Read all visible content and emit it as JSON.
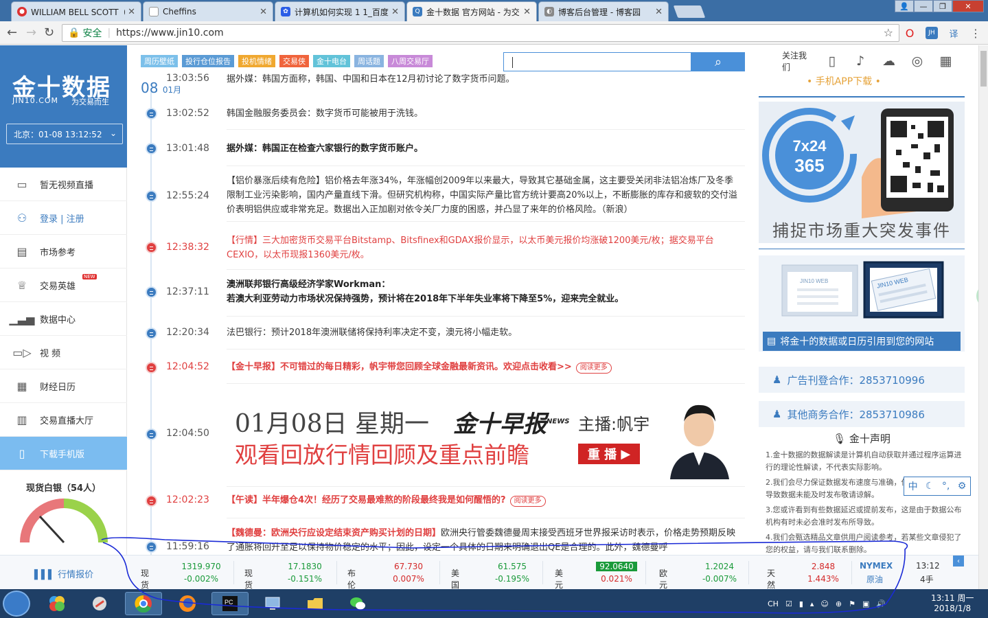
{
  "browser": {
    "tabs": [
      {
        "label": "WILLIAM BELL SCOTT（",
        "icon": "red-circle-icon",
        "active": false
      },
      {
        "label": "Cheffins",
        "icon": "page-icon",
        "active": false
      },
      {
        "label": "计算机如何实现 1 1_百度",
        "icon": "baidu-paw-icon",
        "active": false
      },
      {
        "label": "金十数据 官方网站 - 为交",
        "icon": "jin10-q-icon",
        "active": true
      },
      {
        "label": "博客后台管理 - 博客园",
        "icon": "cnblogs-icon",
        "active": false
      }
    ],
    "secure_label": "安全",
    "url": "https://www.jin10.com"
  },
  "sidebar": {
    "logo": "金十数据",
    "domain": "JIN10.COM",
    "slogan": "为交易而生",
    "clock": "北京：01-08 13:12:52",
    "items": [
      {
        "label": "暂无视频直播",
        "icon": "tv-icon"
      },
      {
        "label": "登录 | 注册",
        "icon": "user-icon"
      },
      {
        "label": "市场参考",
        "icon": "news-icon"
      },
      {
        "label": "交易英雄",
        "icon": "trophy-icon",
        "badge": "NEW"
      },
      {
        "label": "数据中心",
        "icon": "bar-chart-icon"
      },
      {
        "label": "视  频",
        "icon": "video-icon"
      },
      {
        "label": "财经日历",
        "icon": "calendar-icon"
      },
      {
        "label": "交易直播大厅",
        "icon": "live-chart-icon"
      },
      {
        "label": "下载手机版",
        "icon": "phone-icon"
      }
    ],
    "silver_title": "现货白银（54人）"
  },
  "main": {
    "tags": [
      {
        "label": "周历壁纸",
        "color": "#7cc0ea"
      },
      {
        "label": "投行仓位报告",
        "color": "#5b9bd5"
      },
      {
        "label": "投机情绪",
        "color": "#f0a830"
      },
      {
        "label": "交易侠",
        "color": "#f0643c"
      },
      {
        "label": "金十电台",
        "color": "#62c3d9"
      },
      {
        "label": "周话题",
        "color": "#8ab4e0"
      },
      {
        "label": "八周交易厅",
        "color": "#c88ad8"
      }
    ],
    "date_day": "08",
    "date_month": "01月",
    "feed": [
      {
        "time": "13:03:56",
        "text": "据外媒：韩国方面称，韩国、中国和日本在12月初讨论了数字货币问题。",
        "red": false,
        "bold": false
      },
      {
        "time": "13:02:52",
        "text": "韩国金融服务委员会：数字货币可能被用于洗钱。",
        "red": false,
        "bold": false
      },
      {
        "time": "13:01:48",
        "text": "据外媒：韩国正在检查六家银行的数字货币账户。",
        "red": false,
        "bold": true
      },
      {
        "time": "12:55:24",
        "text": "【铝价暴涨后续有危险】铝价格去年涨34%，年涨幅创2009年以来最大，导致其它基础金属，这主要受关闭非法铝冶炼厂及冬季限制工业污染影响，国内产量直线下滑。但研究机构称，中国实际产量比官方统计要高20%以上，不断膨胀的库存和疲软的交付溢价表明铝供应或非常充足。数据出入正加剧对依令关厂力度的困惑，并凸显了来年的价格风险。（新浪）",
        "red": false,
        "bold": false
      },
      {
        "time": "12:38:32",
        "text": "【行情】三大加密货币交易平台Bitstamp、Bitsfinex和GDAX报价显示，以太币美元报价均涨破1200美元/枚；据交易平台CEXIO，以太币现报1360美元/枚。",
        "red": true,
        "bold": false
      },
      {
        "time": "12:37:11",
        "text": "澳洲联邦银行高级经济学家Workman：",
        "text2": "若澳大利亚劳动力市场状况保持强势，预计将在2018年下半年失业率将下降至5%，迎来完全就业。",
        "red": false,
        "bold": true
      },
      {
        "time": "12:20:34",
        "text": "法巴银行：预计2018年澳洲联储将保持利率决定不变，澳元将小幅走软。",
        "red": false,
        "bold": false
      },
      {
        "time": "12:04:52",
        "text": "【金十早报】不可错过的每日精彩，帆宇带您回顾全球金融最新资讯。欢迎点击收看>>",
        "red": true,
        "bold": true,
        "more": "阅读更多"
      },
      {
        "time": "12:04:50",
        "text": "",
        "red": false,
        "bold": false
      },
      {
        "time": "12:02:23",
        "text": "【午读】半年爆仓4次！经历了交易最难熬的阶段最终我是如何醒悟的?",
        "red": true,
        "bold": true,
        "more": "阅读更多"
      },
      {
        "time": "11:59:16",
        "text": "【魏德曼：欧洲央行应设定结束资产购买计划的日期】",
        "text2": "欧洲央行管委魏德曼周末接受西班牙世界报采访时表示，价格走势预期反映了通胀将回升至足以保持物价稳定的水平；因此，设定一个具体的日期来明确退出QE是合理的。此外，魏德曼呼",
        "red": true,
        "bold": true
      }
    ],
    "banner": {
      "line1": "01月08日 星期一",
      "line2": "观看回放行情回顾及重点前瞻",
      "brand": "金十早报",
      "brand_badge": "NEWS",
      "host": "主播:帆宇",
      "replay": "重 播"
    }
  },
  "right": {
    "follow_label": "关注我们",
    "follow_icons": [
      "mobile-icon",
      "music-note-icon",
      "wechat-icon",
      "weibo-icon",
      "grid-icon"
    ],
    "app_download": "•  手机APP下载  •",
    "promo1_badge_line1": "7x24",
    "promo1_badge_line2": "365",
    "promo1_caption": "捕捉市场重大突发事件",
    "promo2_caption": "将金十的数据或日历引用到您的网站",
    "promo2_tag": "JIN10 WEB",
    "ad_coop": "广告刊登合作：2853710996",
    "biz_coop": "其他商务合作：2853710986",
    "decl_title": "金十声明",
    "declarations": [
      "1.金十数据的数据解读是计算机自动获取并通过程序运算进行的理论性解读，不代表实际影响。",
      "2.我们会尽力保证数据发布速度与准确，但会有不可控因素导致数据未能及时发布敬请谅解。",
      "3.您或许看到有些数据延迟或提前发布，这是由于数据公布机构有时未必会准时发布所导致。",
      "4.我们会甄选精品文章供用户阅读参考，若某些文章侵犯了您的权益，请与我们联系删除。"
    ],
    "float_badge": "59"
  },
  "ime": [
    "中",
    "☾",
    "°,",
    "⚙"
  ],
  "quotes": {
    "label": "行情报价",
    "items": [
      {
        "name": "现货黄金",
        "value": "1319.970",
        "change": "-0.002%",
        "dir": "dn"
      },
      {
        "name": "现货白银",
        "value": "17.1830",
        "change": "-0.151%",
        "dir": "dn"
      },
      {
        "name": "布伦特油",
        "value": "67.730",
        "change": "0.007%",
        "dir": "up"
      },
      {
        "name": "美国原油",
        "value": "61.575",
        "change": "-0.195%",
        "dir": "dn"
      },
      {
        "name": "美元指数",
        "value": "92.0640",
        "change": "0.021%",
        "dir": "up",
        "highlight": true
      },
      {
        "name": "欧元美元",
        "value": "1.2024",
        "change": "-0.007%",
        "dir": "dn"
      },
      {
        "name": "天然气",
        "value": "2.848",
        "change": "1.443%",
        "dir": "up"
      }
    ],
    "nymex": "NYMEX",
    "nymex_sub": "原油",
    "time": "13:12",
    "hands": "4手"
  },
  "taskbar": {
    "ime_label": "CH",
    "clock_time": "13:11 周一",
    "clock_date": "2018/1/8"
  },
  "colors": {
    "brand_blue": "#3b7bbf",
    "accent_red": "#e04040",
    "menu_active": "#7bbcf0"
  }
}
